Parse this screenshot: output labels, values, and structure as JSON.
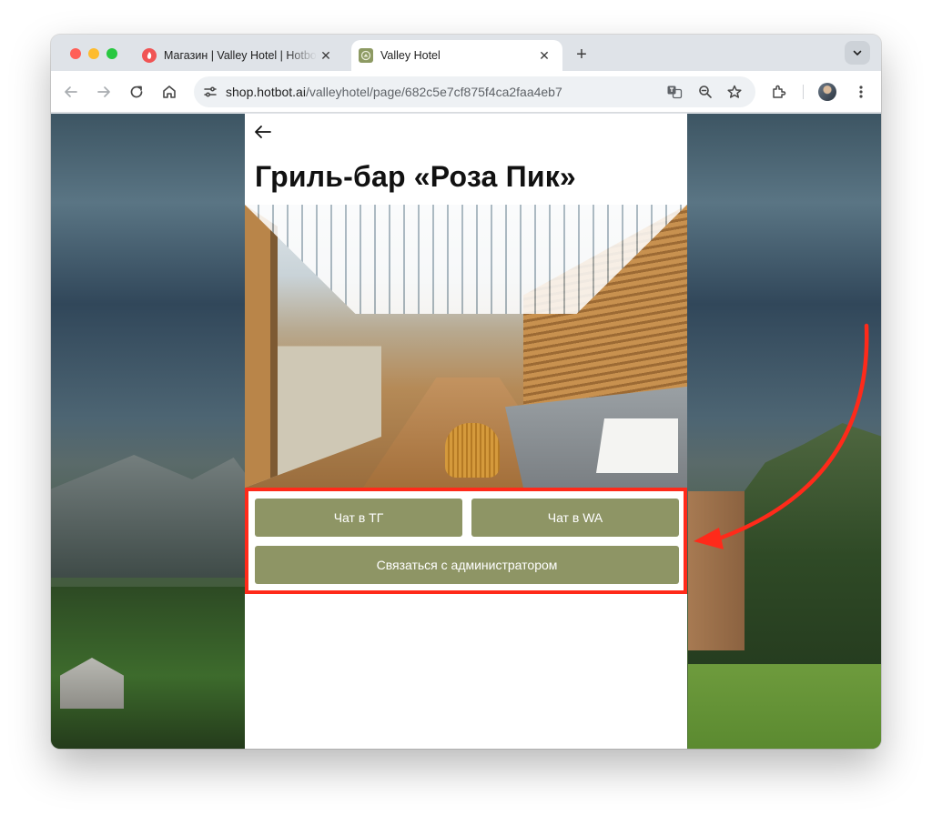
{
  "browser": {
    "tabs": [
      {
        "title": "Магазин | Valley Hotel | Hotbot",
        "active": false,
        "favicon": "hotbot-icon"
      },
      {
        "title": "Valley Hotel",
        "active": true,
        "favicon": "valley-hotel-icon"
      }
    ],
    "url_domain": "shop.hotbot.ai",
    "url_path": "/valleyhotel/page/682c5e7cf875f4ca2faa4eb7"
  },
  "page": {
    "title": "Гриль-бар «Роза Пик»",
    "buttons": {
      "chat_tg": "Чат в ТГ",
      "chat_wa": "Чат в WA",
      "contact_admin": "Связаться с администратором"
    }
  },
  "colors": {
    "button": "#8e9565",
    "highlight": "#ff2a1a"
  }
}
